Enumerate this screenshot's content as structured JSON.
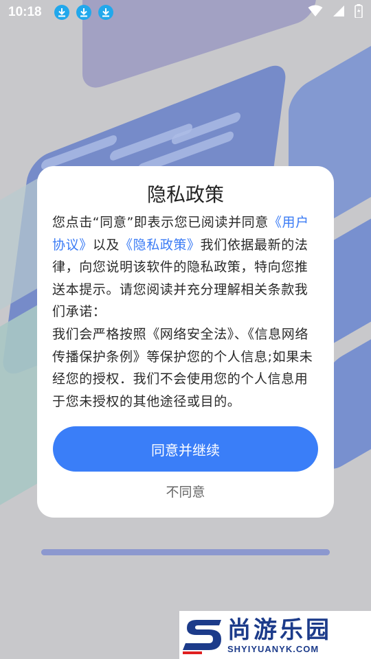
{
  "status_bar": {
    "time": "10:18",
    "icons": [
      "download-icon",
      "download-icon",
      "download-icon",
      "wifi-icon",
      "signal-icon",
      "battery-icon"
    ]
  },
  "dialog": {
    "title": "隐私政策",
    "body": {
      "p1_before": "您点击“同意”即表示您已阅读并同意",
      "link_user_agreement": "《用户协议》",
      "p1_mid": "以及",
      "link_privacy_policy": "《隐私政策》",
      "p1_after": "我们依据最新的法律，向您说明该软件的隐私政策，特向您推送本提示。请您阅读并充分理解相关条款我们承诺：",
      "p2": "我们会严格按照《网络安全法》、《信息网络传播保护条例》等保护您的个人信息;如果未经您的授权．我们不会使用您的个人信息用于您未授权的其他途径或目的。"
    },
    "agree_button": "同意并继续",
    "disagree_button": "不同意"
  },
  "progress": {
    "value": 1.0
  },
  "watermark": {
    "name_cn": "尚游乐园",
    "domain": "SHYIYUANYK.COM"
  },
  "colors": {
    "accent": "#3a7ef8",
    "link": "#3a7bf5",
    "watermark": "#1c3b8a"
  }
}
